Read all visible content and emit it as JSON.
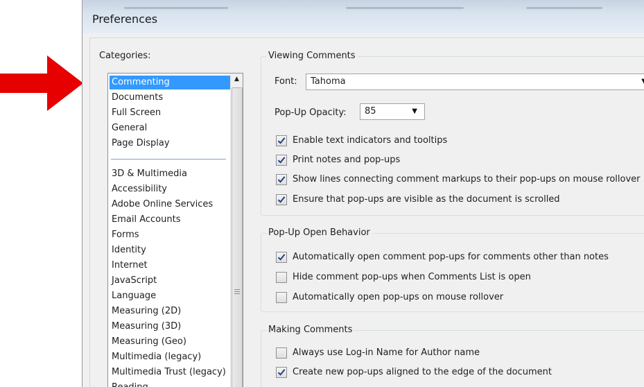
{
  "window": {
    "title": "Preferences"
  },
  "categories": {
    "label": "Categories:",
    "items_top": [
      "Commenting",
      "Documents",
      "Full Screen",
      "General",
      "Page Display"
    ],
    "items_bottom": [
      "3D & Multimedia",
      "Accessibility",
      "Adobe Online Services",
      "Email Accounts",
      "Forms",
      "Identity",
      "Internet",
      "JavaScript",
      "Language",
      "Measuring (2D)",
      "Measuring (3D)",
      "Measuring (Geo)",
      "Multimedia (legacy)",
      "Multimedia Trust (legacy)",
      "Reading"
    ],
    "selected": "Commenting"
  },
  "viewing": {
    "title": "Viewing Comments",
    "font_label": "Font:",
    "font_value": "Tahoma",
    "opacity_label": "Pop-Up Opacity:",
    "opacity_value": "85",
    "checks": [
      {
        "label": "Enable text indicators and tooltips",
        "checked": true
      },
      {
        "label": "Print notes and pop-ups",
        "checked": true
      },
      {
        "label": "Show lines connecting comment markups to their pop-ups on mouse rollover",
        "checked": true
      },
      {
        "label": "Ensure that pop-ups are visible as the document is scrolled",
        "checked": true
      }
    ]
  },
  "popup": {
    "title": "Pop-Up Open Behavior",
    "checks": [
      {
        "label": "Automatically open comment pop-ups for comments other than notes",
        "checked": true
      },
      {
        "label": "Hide comment pop-ups when Comments List is open",
        "checked": false
      },
      {
        "label": "Automatically open pop-ups on mouse rollover",
        "checked": false
      }
    ]
  },
  "making": {
    "title": "Making Comments",
    "checks": [
      {
        "label": "Always use Log-in Name for Author name",
        "checked": false
      },
      {
        "label": "Create new pop-ups aligned to the edge of the document",
        "checked": true
      }
    ]
  },
  "colors": {
    "arrow": "#e60000",
    "selection": "#3399ff",
    "dialog": "#f0f0f0"
  },
  "icons": {
    "scroll_up": "▲",
    "dropdown": "▼"
  }
}
